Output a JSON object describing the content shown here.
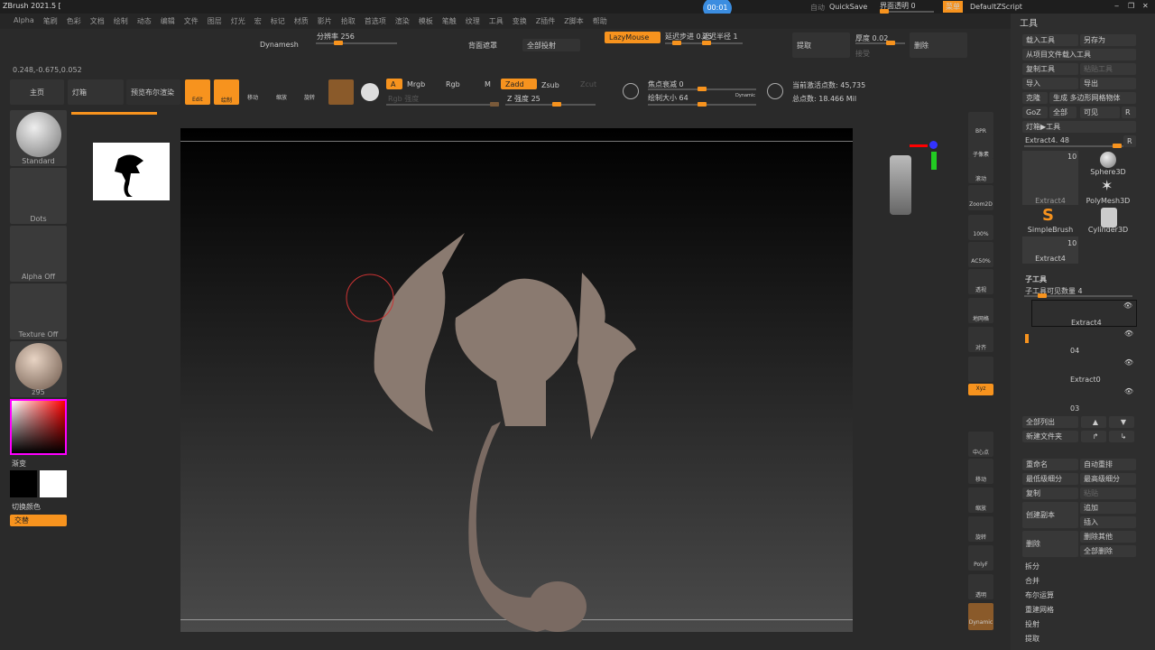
{
  "app": {
    "title": "ZBrush 2021.5 [",
    "timer": "00:01",
    "auto": "自动",
    "quicksave": "QuickSave",
    "ui_transparency": "界面透明 0",
    "menu_btn": "菜单",
    "zscript": "DefaultZScript"
  },
  "menu": [
    "Alpha",
    "笔刷",
    "色彩",
    "文档",
    "绘制",
    "动态",
    "编辑",
    "文件",
    "图层",
    "灯光",
    "宏",
    "标记",
    "材质",
    "影片",
    "拾取",
    "首选项",
    "渲染",
    "模板",
    "笔触",
    "纹理",
    "工具",
    "变换",
    "Z插件",
    "Z脚本",
    "帮助"
  ],
  "top": {
    "dynamesh": "Dynamesh",
    "resolution": "分辨率 256",
    "backface": "背面遮罩",
    "project_all": "全部投射",
    "lazymouse": "LazyMouse",
    "lazy_step": "延迟步进 0.25",
    "lazy_radius": "延迟半径 1",
    "extract": "提取",
    "thickness": "厚度 0.02",
    "accept": "接受",
    "delete": "删除"
  },
  "coords": "0.248,-0.675,0.052",
  "toolbar": {
    "home": "主页",
    "lightbox": "灯箱",
    "bool_preview": "预览布尔渲染",
    "edit": "Edit",
    "draw": "绘制",
    "move": "移动",
    "scale": "缩放",
    "rotate": "旋转",
    "a": "A",
    "mrgb": "Mrgb",
    "rgb": "Rgb",
    "m": "M",
    "zadd": "Zadd",
    "zsub": "Zsub",
    "zcut": "Zcut",
    "rgb_intensity": "Rgb 强度",
    "z_intensity": "Z 强度 25",
    "focal": "焦点衰减 0",
    "draw_size": "绘制大小 64",
    "dynamic": "Dynamic",
    "active_points": "当前激活点数: 45,735",
    "total_points": "总点数: 18.466 Mil"
  },
  "left": {
    "brush": "Standard",
    "stroke": "Dots",
    "alpha": "Alpha Off",
    "texture": "Texture Off",
    "material": "z95",
    "gradient": "渐变",
    "switch_color": "切换颜色",
    "alternate": "交替"
  },
  "shelf": [
    "BPR",
    "子像素",
    "滚动",
    "Zoom2D",
    "100%",
    "AC50%",
    "透视",
    "地网格",
    "对齐",
    "",
    "Xyz",
    "中心点",
    "移动",
    "缩放",
    "旋转",
    "PolyF",
    "透明",
    "Dynamic"
  ],
  "right": {
    "title": "工具",
    "load": "载入工具",
    "save_as": "另存为",
    "load_project": "从项目文件载入工具",
    "copy_tool": "复制工具",
    "paste_tool": "粘贴工具",
    "import": "导入",
    "export": "导出",
    "clone": "克隆",
    "make_polymesh": "生成 多边形网格物体",
    "goz": "GoZ",
    "all": "全部",
    "visible": "可见",
    "r": "R",
    "lightbox_tools": "灯箱▶工具",
    "current_tool": "Extract4. 48",
    "tools": [
      {
        "name": "Extract4",
        "count": "10"
      },
      {
        "name": "Sphere3D"
      },
      {
        "name": "PolyMesh3D"
      },
      {
        "name": "SimpleBrush"
      },
      {
        "name": "Cylinder3D"
      },
      {
        "name": "Extract4",
        "count": "10"
      }
    ],
    "subtool_title": "子工具",
    "subtool_visible": "子工具可见数量 4",
    "subtools": [
      "Extract4",
      "04",
      "Extract0",
      "03"
    ],
    "list_all": "全部列出",
    "new_folder": "新建文件夹",
    "rename": "重命名",
    "auto_reorder": "自动重排",
    "lowest_sub": "最低级细分",
    "highest_sub": "最高级细分",
    "duplicate": "复制",
    "paste": "粘贴",
    "create_copy": "创建副本",
    "append": "追加",
    "insert": "插入",
    "del": "删除",
    "del_other": "删除其他",
    "del_all": "全部删除",
    "sections": [
      "拆分",
      "合并",
      "布尔运算",
      "重建网格",
      "投射",
      "提取"
    ]
  },
  "colors": {
    "accent": "#f7931e"
  }
}
